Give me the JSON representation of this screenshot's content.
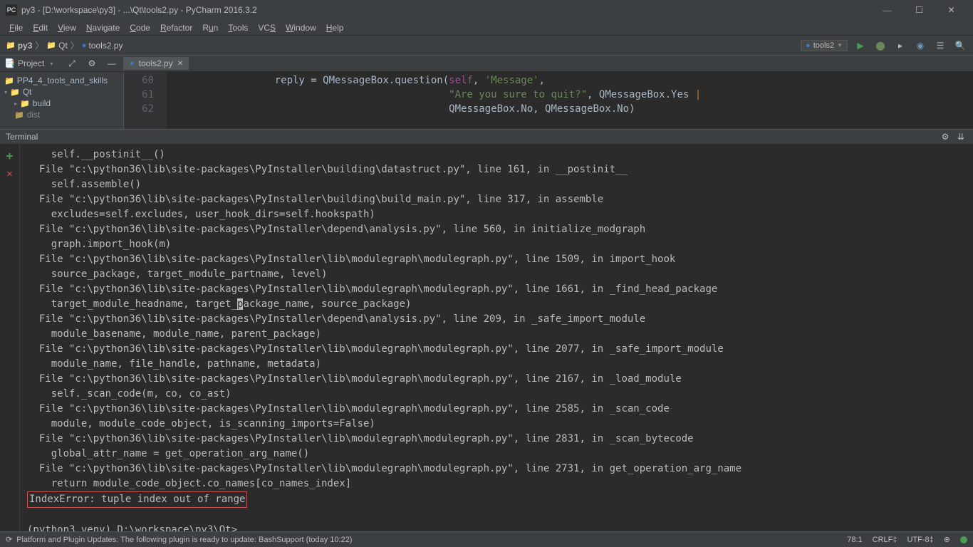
{
  "titlebar": {
    "icon_label": "PC",
    "title": "py3 - [D:\\workspace\\py3] - ...\\Qt\\tools2.py - PyCharm 2016.3.2"
  },
  "menubar": {
    "file": "File",
    "edit": "Edit",
    "view": "View",
    "navigate": "Navigate",
    "code": "Code",
    "refactor": "Refactor",
    "run": "Run",
    "tools": "Tools",
    "vcs": "VCS",
    "window": "Window",
    "help": "Help"
  },
  "breadcrumb": {
    "c0": "py3",
    "c1": "Qt",
    "c2": "tools2.py"
  },
  "config": {
    "selected": "tools2"
  },
  "project_tool": "Project",
  "tree": {
    "n0": "PP4_4_tools_and_skills",
    "n1": "Qt",
    "n2": "build",
    "n3": "dist"
  },
  "editor_tab": "tools2.py",
  "gutter": {
    "l60": "60",
    "l61": "61",
    "l62": "62"
  },
  "code": {
    "l60a": "reply = QMessageBox.question(",
    "l60self": "self",
    "l60b": ", ",
    "l60msg": "'Message'",
    "l60c": ",",
    "l61str": "\"Are you sure to quit?\"",
    "l61b": ", QMessageBox.Yes ",
    "l61pipe": "|",
    "l62": "QMessageBox.No, QMessageBox.No)"
  },
  "terminal": {
    "title": "Terminal",
    "lines": {
      "t0": "    self.__postinit__()",
      "t1": "  File \"c:\\python36\\lib\\site-packages\\PyInstaller\\building\\datastruct.py\", line 161, in __postinit__",
      "t2": "    self.assemble()",
      "t3": "  File \"c:\\python36\\lib\\site-packages\\PyInstaller\\building\\build_main.py\", line 317, in assemble",
      "t4": "    excludes=self.excludes, user_hook_dirs=self.hookspath)",
      "t5": "  File \"c:\\python36\\lib\\site-packages\\PyInstaller\\depend\\analysis.py\", line 560, in initialize_modgraph",
      "t6": "    graph.import_hook(m)",
      "t7": "  File \"c:\\python36\\lib\\site-packages\\PyInstaller\\lib\\modulegraph\\modulegraph.py\", line 1509, in import_hook",
      "t8": "    source_package, target_module_partname, level)",
      "t9": "  File \"c:\\python36\\lib\\site-packages\\PyInstaller\\lib\\modulegraph\\modulegraph.py\", line 1661, in _find_head_package",
      "t10a": "    target_module_headname, target_",
      "t10b": "ackage_name, source_package)",
      "t11": "  File \"c:\\python36\\lib\\site-packages\\PyInstaller\\depend\\analysis.py\", line 209, in _safe_import_module",
      "t12": "    module_basename, module_name, parent_package)",
      "t13": "  File \"c:\\python36\\lib\\site-packages\\PyInstaller\\lib\\modulegraph\\modulegraph.py\", line 2077, in _safe_import_module",
      "t14": "    module_name, file_handle, pathname, metadata)",
      "t15": "  File \"c:\\python36\\lib\\site-packages\\PyInstaller\\lib\\modulegraph\\modulegraph.py\", line 2167, in _load_module",
      "t16": "    self._scan_code(m, co, co_ast)",
      "t17": "  File \"c:\\python36\\lib\\site-packages\\PyInstaller\\lib\\modulegraph\\modulegraph.py\", line 2585, in _scan_code",
      "t18": "    module, module_code_object, is_scanning_imports=False)",
      "t19": "  File \"c:\\python36\\lib\\site-packages\\PyInstaller\\lib\\modulegraph\\modulegraph.py\", line 2831, in _scan_bytecode",
      "t20": "    global_attr_name = get_operation_arg_name()",
      "t21": "  File \"c:\\python36\\lib\\site-packages\\PyInstaller\\lib\\modulegraph\\modulegraph.py\", line 2731, in get_operation_arg_name",
      "t22": "    return module_code_object.co_names[co_names_index]",
      "t23": "IndexError: tuple index out of range",
      "t24": " ",
      "t25": "(python3_venv) D:\\workspace\\py3\\Qt>"
    }
  },
  "statusbar": {
    "msg": "Platform and Plugin Updates: The following plugin is ready to update: BashSupport (today 10:22)",
    "pos": "78:1",
    "eol": "CRLF",
    "enc": "UTF-8",
    "ctx": "⊕"
  }
}
